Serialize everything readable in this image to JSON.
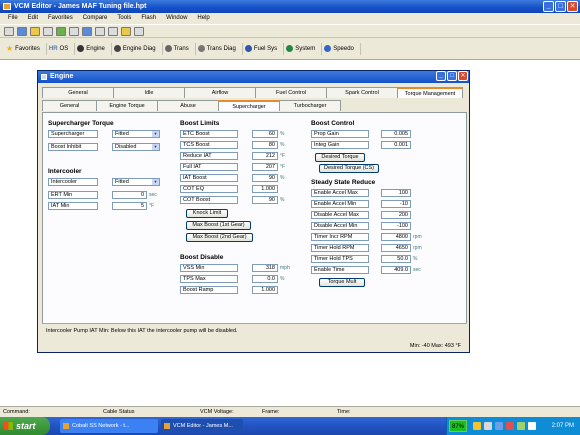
{
  "app": {
    "title": "VCM Editor - James MAF Tuning file.hpt",
    "window_buttons": [
      "_",
      "□",
      "✕"
    ]
  },
  "menu": [
    "File",
    "Edit",
    "Favorites",
    "Compare",
    "Tools",
    "Flash",
    "Window",
    "Help"
  ],
  "toolbar2": [
    {
      "label": "Favorites",
      "icon": "star-icon",
      "color": "#e8b020"
    },
    {
      "label": "OS",
      "icon": "chip-icon",
      "color": "#5577aa",
      "prefix": "HR"
    },
    {
      "label": "Engine",
      "icon": "engine-icon",
      "color": "#333333"
    },
    {
      "label": "Engine Diag",
      "icon": "engine-diag-icon",
      "color": "#444444"
    },
    {
      "label": "Trans",
      "icon": "trans-icon",
      "color": "#666666"
    },
    {
      "label": "Trans Diag",
      "icon": "trans-diag-icon",
      "color": "#777777"
    },
    {
      "label": "Fuel Sys",
      "icon": "fuel-icon",
      "color": "#3355aa"
    },
    {
      "label": "System",
      "icon": "system-icon",
      "color": "#228844"
    },
    {
      "label": "Speedo",
      "icon": "speedo-icon",
      "color": "#3366cc"
    }
  ],
  "engine_window": {
    "title": "Engine",
    "tabs_top": [
      "General",
      "Idle",
      "Airflow",
      "Fuel Control",
      "Spark Control",
      "Torque Management"
    ],
    "tabs_bottom": [
      "General",
      "Engine Torque",
      "Abuse",
      "Supercharger",
      "Turbocharger"
    ],
    "active_tab_bottom": "Supercharger",
    "supercharger_torque": {
      "heading": "Supercharger Torque",
      "supercharger_label": "Supercharger",
      "supercharger_value": "Fitted",
      "boost_inhibit_label": "Boost Inhibit",
      "boost_inhibit_value": "Disabled"
    },
    "intercooler": {
      "heading": "Intercooler",
      "intercooler_label": "Intercooler",
      "intercooler_value": "Fitted",
      "ert_min_label": "ERT Min",
      "ert_min_value": "0",
      "ert_min_unit": "sec",
      "iat_min_label": "IAT Min",
      "iat_min_value": "5",
      "iat_min_unit": "°F"
    },
    "boost_limits": {
      "heading": "Boost Limits",
      "rows": [
        {
          "label": "ETC Boost",
          "value": "60",
          "unit": "%"
        },
        {
          "label": "TCS Boost",
          "value": "80",
          "unit": "%"
        },
        {
          "label": "Reduce IAT",
          "value": "212",
          "unit": "°F"
        },
        {
          "label": "Full IAT",
          "value": "207",
          "unit": "°F"
        },
        {
          "label": "IAT Boost",
          "value": "90",
          "unit": "%"
        },
        {
          "label": "COT EQ",
          "value": "1.000",
          "unit": ""
        },
        {
          "label": "COT Boost",
          "value": "90",
          "unit": "%"
        }
      ],
      "buttons": [
        "Knock Limit",
        "Max Boost (1st Gear)",
        "Max Boost (2nd Gear)"
      ]
    },
    "boost_disable": {
      "heading": "Boost Disable",
      "rows": [
        {
          "label": "VSS Min",
          "value": "318",
          "unit": "mph"
        },
        {
          "label": "TPS Max",
          "value": "0.0",
          "unit": "%"
        },
        {
          "label": "Boost Ramp",
          "value": "1.000",
          "unit": ""
        }
      ]
    },
    "boost_control": {
      "heading": "Boost Control",
      "rows": [
        {
          "label": "Prop Gain",
          "value": "0.005"
        },
        {
          "label": "Integ Gain",
          "value": "0.001"
        }
      ],
      "buttons": [
        "Desired Torque",
        "Desired Torque (CS)"
      ]
    },
    "steady_state_reduce": {
      "heading": "Steady State Reduce",
      "rows": [
        {
          "label": "Enable Accel Max",
          "value": "100",
          "unit": ""
        },
        {
          "label": "Enable Accel Min",
          "value": "-10",
          "unit": ""
        },
        {
          "label": "Disable Accel Max",
          "value": "200",
          "unit": ""
        },
        {
          "label": "Disable Accel Min",
          "value": "-100",
          "unit": ""
        },
        {
          "label": "Timer Incr RPM",
          "value": "4800",
          "unit": "rpm"
        },
        {
          "label": "Timer Hold RPM",
          "value": "4650",
          "unit": "rpm"
        },
        {
          "label": "Timer Hold TPS",
          "value": "50.0",
          "unit": "%"
        },
        {
          "label": "Enable Time",
          "value": "409.0",
          "unit": "sec"
        }
      ],
      "buttons": [
        "Torque Mult"
      ]
    },
    "info_text": "Intercooler Pump IAT Min: Below this IAT the intercooler pump will be disabled.",
    "min_max_text": "Min: -40 Max: 493 °F"
  },
  "statusbar": {
    "command": "Command:",
    "cable_status": "Cable Status",
    "vcm_voltage": "VCM Voltage:",
    "frame": "Frame:",
    "time": "Time:"
  },
  "taskbar": {
    "start_label": "start",
    "tasks": [
      "Cobalt SS Network - t...",
      "VCM Editor - James M..."
    ],
    "tray_percent": "87%",
    "clock": "2:07 PM"
  }
}
